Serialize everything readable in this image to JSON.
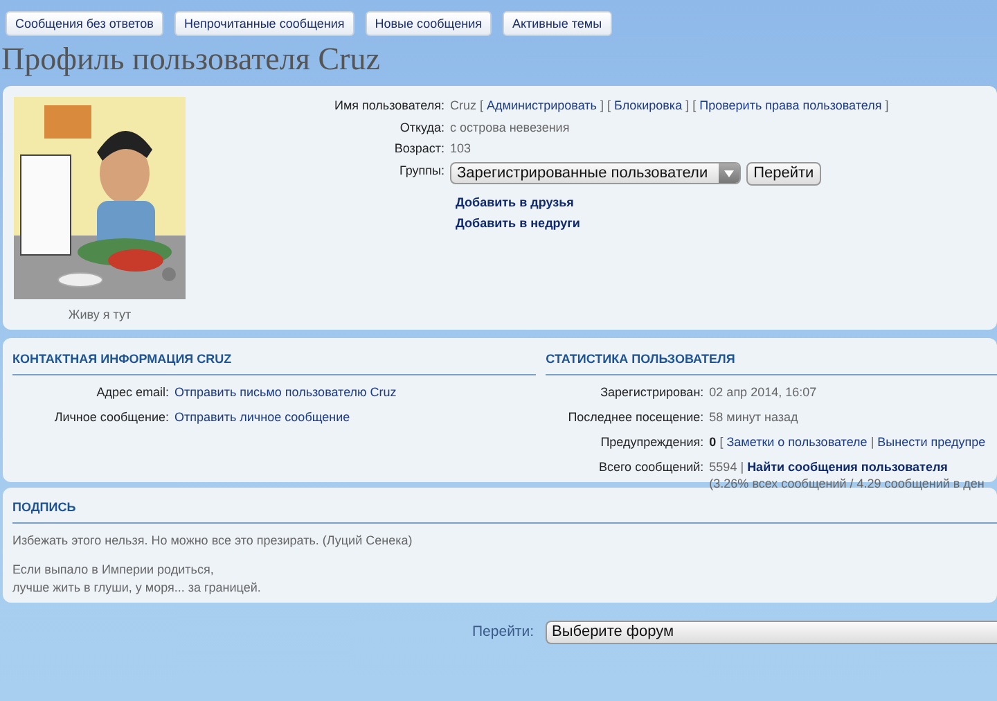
{
  "nav_buttons": [
    "Сообщения без ответов",
    "Непрочитанные сообщения",
    "Новые сообщения",
    "Активные темы"
  ],
  "title": "Профиль пользователя Cruz",
  "profile": {
    "avatar": {
      "caption": "Живу я тут"
    },
    "rows": [
      {
        "label": "Имя пользователя:",
        "kind": "parts",
        "parts": [
          {
            "kind": "text",
            "text": "Cruz ["
          },
          {
            "kind": "link",
            "text": "Администрировать"
          },
          {
            "kind": "text",
            "text": "] ["
          },
          {
            "kind": "link",
            "text": "Блокировка"
          },
          {
            "kind": "text",
            "text": "] ["
          },
          {
            "kind": "link",
            "text": "Проверить права пользователя"
          },
          {
            "kind": "text",
            "text": "]"
          }
        ]
      },
      {
        "label": "Откуда:",
        "kind": "parts",
        "parts": [
          {
            "kind": "text",
            "text": "с острова невезения"
          }
        ]
      },
      {
        "label": "Возраст:",
        "kind": "parts",
        "parts": [
          {
            "kind": "text",
            "text": "103"
          }
        ]
      },
      {
        "label": "Группы:",
        "kind": "select",
        "value": "Зарегистрированные пользователи",
        "button": "Перейти"
      }
    ],
    "actions": [
      "Добавить в друзья",
      "Добавить в недруги"
    ]
  },
  "contact": {
    "title": "КОНТАКТНАЯ ИНФОРМАЦИЯ CRUZ",
    "rows": [
      {
        "label": "Адрес email:",
        "parts": [
          {
            "kind": "link",
            "text": "Отправить письмо пользователю Cruz"
          }
        ]
      },
      {
        "label": "Личное сообщение:",
        "parts": [
          {
            "kind": "link",
            "text": "Отправить личное сообщение"
          }
        ]
      }
    ]
  },
  "stats": {
    "title": "СТАТИСТИКА ПОЛЬЗОВАТЕЛЯ",
    "rows": [
      {
        "label": "Зарегистрирован:",
        "parts": [
          {
            "kind": "text",
            "text": "02 апр 2014, 16:07"
          }
        ]
      },
      {
        "label": "Последнее посещение:",
        "parts": [
          {
            "kind": "text",
            "text": "58 минут назад"
          }
        ]
      },
      {
        "label": "Предупреждения:",
        "parts": [
          {
            "kind": "bold",
            "text": "0"
          },
          {
            "kind": "text",
            "text": "["
          },
          {
            "kind": "link",
            "text": "Заметки о пользователе"
          },
          {
            "kind": "text",
            "text": "|"
          },
          {
            "kind": "link",
            "text": "Вынести предупре"
          }
        ]
      },
      {
        "label": "Всего сообщений:",
        "parts": [
          {
            "kind": "text",
            "text": "5594 |"
          },
          {
            "kind": "boldlink",
            "text": "Найти сообщения пользователя"
          }
        ],
        "note": "(3.26% всех сообщений / 4.29 сообщений в ден"
      }
    ]
  },
  "signature": {
    "title": "ПОДПИСЬ",
    "paragraphs": [
      [
        "Избежать этого нельзя. Но можно все это презирать. (Луций Сенека)"
      ],
      [
        "Если выпало в Империи родиться,",
        "лучше жить в глуши, у моря... за границей."
      ]
    ]
  },
  "jump": {
    "label": "Перейти:",
    "value": "Выберите форум"
  }
}
